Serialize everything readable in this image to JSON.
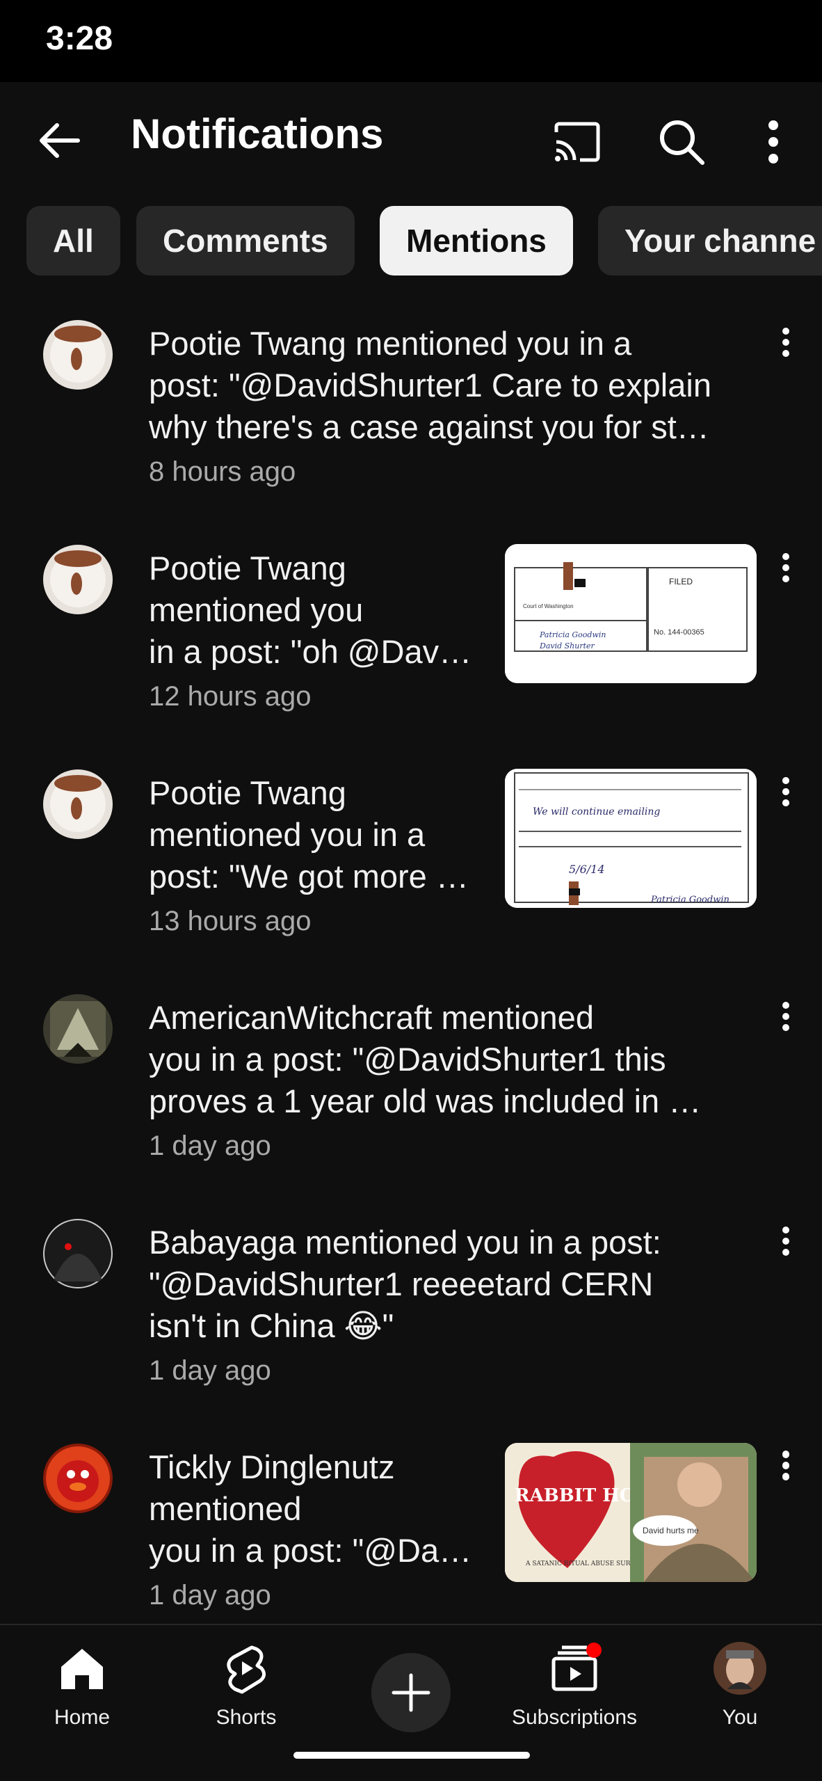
{
  "status_bar": {
    "time": "3:28"
  },
  "header": {
    "title": "Notifications",
    "icons": [
      "back-arrow-icon",
      "cast-icon",
      "search-icon",
      "more-vertical-icon"
    ]
  },
  "chips": [
    {
      "label": "All",
      "active": false
    },
    {
      "label": "Comments",
      "active": false
    },
    {
      "label": "Mentions",
      "active": true
    },
    {
      "label": "Your channe",
      "active": false
    }
  ],
  "notifications": [
    {
      "lines": [
        "Pootie Twang mentioned you in a",
        "post: \"@DavidShurter1 Care to explain",
        "why there's a case against you for st…"
      ],
      "time": "8 hours ago",
      "has_thumbnail": false
    },
    {
      "lines": [
        "Pootie Twang",
        "mentioned you",
        "in a post: \"oh @Dav…"
      ],
      "time": "12 hours ago",
      "has_thumbnail": true,
      "thumbnail": {
        "court": "Court of Washington",
        "status": "FILED",
        "case_no": "No. 144-00365",
        "petitioner": "Patricia Goodwin",
        "respondent": "David Shurter"
      }
    },
    {
      "lines": [
        "Pootie Twang",
        "mentioned you in a",
        "post: \"We got more …"
      ],
      "time": "13 hours ago",
      "has_thumbnail": true,
      "thumbnail": {
        "handwritten": "We will continue emailing",
        "date": "5/6/14",
        "signature": "Patricia Goodwin"
      }
    },
    {
      "lines": [
        "AmericanWitchcraft mentioned",
        "you in a post: \"@DavidShurter1 this",
        "proves a 1 year old was included in …"
      ],
      "time": "1 day ago",
      "has_thumbnail": false
    },
    {
      "lines": [
        "Babayaga mentioned you in a post:",
        "\"@DavidShurter1  reeeetard CERN",
        "isn't in China 😂\""
      ],
      "time": "1 day ago",
      "has_thumbnail": false
    },
    {
      "lines": [
        "Tickly Dinglenutz",
        "mentioned",
        "you in a post: \"@Da…"
      ],
      "time": "1 day ago",
      "has_thumbnail": true,
      "thumbnail": {
        "title": "RABBIT HOLE",
        "caption": "David hurts me",
        "subtitle": "A SATANIC RITUAL ABUSE SURVIVOR'S STORY"
      }
    }
  ],
  "bottom_nav": {
    "items": [
      {
        "label": "Home",
        "icon": "home-icon"
      },
      {
        "label": "Shorts",
        "icon": "shorts-icon"
      },
      {
        "label": "",
        "icon": "create-plus-icon"
      },
      {
        "label": "Subscriptions",
        "icon": "subscriptions-icon"
      },
      {
        "label": "You",
        "icon": "avatar"
      }
    ]
  },
  "colors": {
    "background": "#0f0f0f",
    "chip": "#272727",
    "chip_active": "#f1f1f1",
    "secondary_text": "#aaaaaa",
    "badge": "#ff0000"
  }
}
